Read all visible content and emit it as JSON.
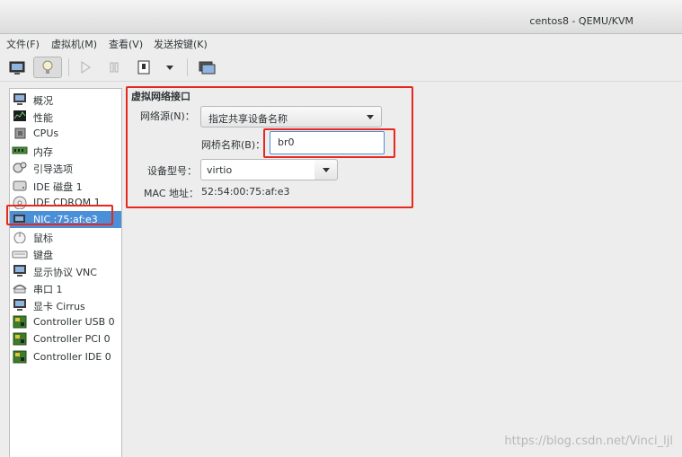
{
  "window": {
    "title": "centos8 - QEMU/KVM"
  },
  "menu": [
    {
      "label": "文件(F)"
    },
    {
      "label": "虚拟机(M)"
    },
    {
      "label": "查看(V)"
    },
    {
      "label": "发送按键(K)"
    }
  ],
  "toolbar": {
    "icons": [
      "monitor-icon",
      "lightbulb-icon",
      "play-icon",
      "pause-icon",
      "power-icon",
      "dropdown-arrow-icon",
      "screenshot-icon"
    ]
  },
  "sidebar": {
    "items": [
      {
        "label": "概况",
        "icon": "overview-icon"
      },
      {
        "label": "性能",
        "icon": "performance-icon"
      },
      {
        "label": "CPUs",
        "icon": "cpu-icon"
      },
      {
        "label": "内存",
        "icon": "memory-icon"
      },
      {
        "label": "引导选项",
        "icon": "boot-icon"
      },
      {
        "label": "IDE 磁盘 1",
        "icon": "disk-icon"
      },
      {
        "label": "IDE CDROM 1",
        "icon": "cdrom-icon"
      },
      {
        "label": "NIC :75:af:e3",
        "icon": "nic-icon",
        "selected": true
      },
      {
        "label": "鼠标",
        "icon": "mouse-icon"
      },
      {
        "label": "键盘",
        "icon": "keyboard-icon"
      },
      {
        "label": "显示协议  VNC",
        "icon": "display-icon"
      },
      {
        "label": "串口 1",
        "icon": "serial-icon"
      },
      {
        "label": "显卡  Cirrus",
        "icon": "video-icon"
      },
      {
        "label": "Controller USB 0",
        "icon": "controller-icon"
      },
      {
        "label": "Controller PCI 0",
        "icon": "controller-icon"
      },
      {
        "label": "Controller IDE 0",
        "icon": "controller-icon"
      }
    ]
  },
  "nic": {
    "section_title": "虚拟网络接口",
    "source_label": "网络源(N)：",
    "source_value": "指定共享设备名称",
    "bridge_label": "网桥名称(B)：",
    "bridge_value": "br0",
    "model_label": "设备型号：",
    "model_value": "virtio",
    "mac_label": "MAC 地址：",
    "mac_value": "52:54:00:75:af:e3"
  },
  "watermark": "https://blog.csdn.net/Vinci_ljl",
  "colors": {
    "selection": "#4a90d9",
    "annotation": "#e8281f"
  }
}
